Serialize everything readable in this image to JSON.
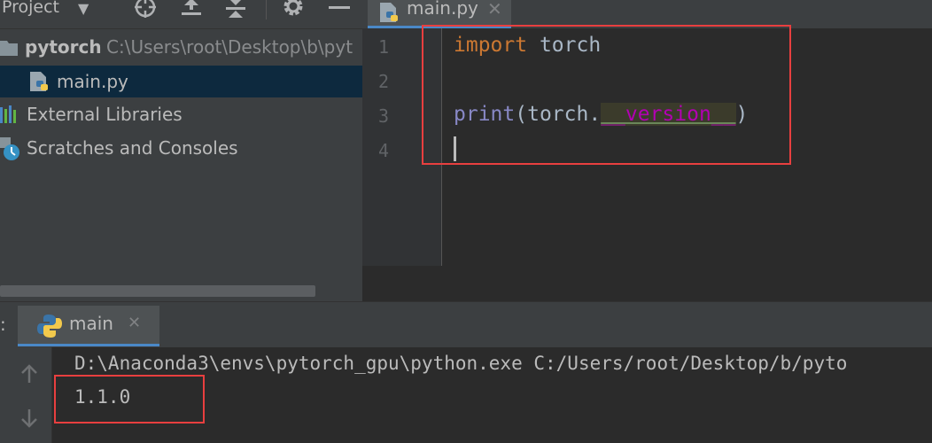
{
  "project_panel": {
    "title": "Project",
    "tree": [
      {
        "label": "pytorch",
        "path": "C:\\Users\\root\\Desktop\\b\\pyt"
      },
      {
        "label": "main.py"
      },
      {
        "label": "External Libraries"
      },
      {
        "label": "Scratches and Consoles"
      }
    ]
  },
  "editor": {
    "tab_label": "main.py",
    "line_numbers": [
      "1",
      "2",
      "3",
      "4"
    ],
    "line1": {
      "keyword": "import",
      "rest": " torch"
    },
    "line3": {
      "fn": "print",
      "open": "(torch.",
      "dunder": "__version__",
      "close": ")"
    }
  },
  "run_panel": {
    "side_label": ":",
    "tab_label": "main",
    "command": "D:\\Anaconda3\\envs\\pytorch_gpu\\python.exe C:/Users/root/Desktop/b/pyto",
    "output": "1.1.0"
  },
  "colors": {
    "keyword": "#cc7832",
    "builtin": "#8888c6",
    "dunder": "#b200b2",
    "selection": "#0d293e",
    "highlight_box": "#e83f3f",
    "tab_underline": "#4a88c7"
  },
  "icons": [
    "chevron-down-icon",
    "crosshair-icon",
    "expand-all-icon",
    "collapse-all-icon",
    "gear-icon",
    "minimize-icon",
    "folder-icon",
    "python-file-icon",
    "libraries-icon",
    "scratches-icon",
    "close-icon",
    "arrow-up-icon",
    "arrow-down-icon"
  ]
}
